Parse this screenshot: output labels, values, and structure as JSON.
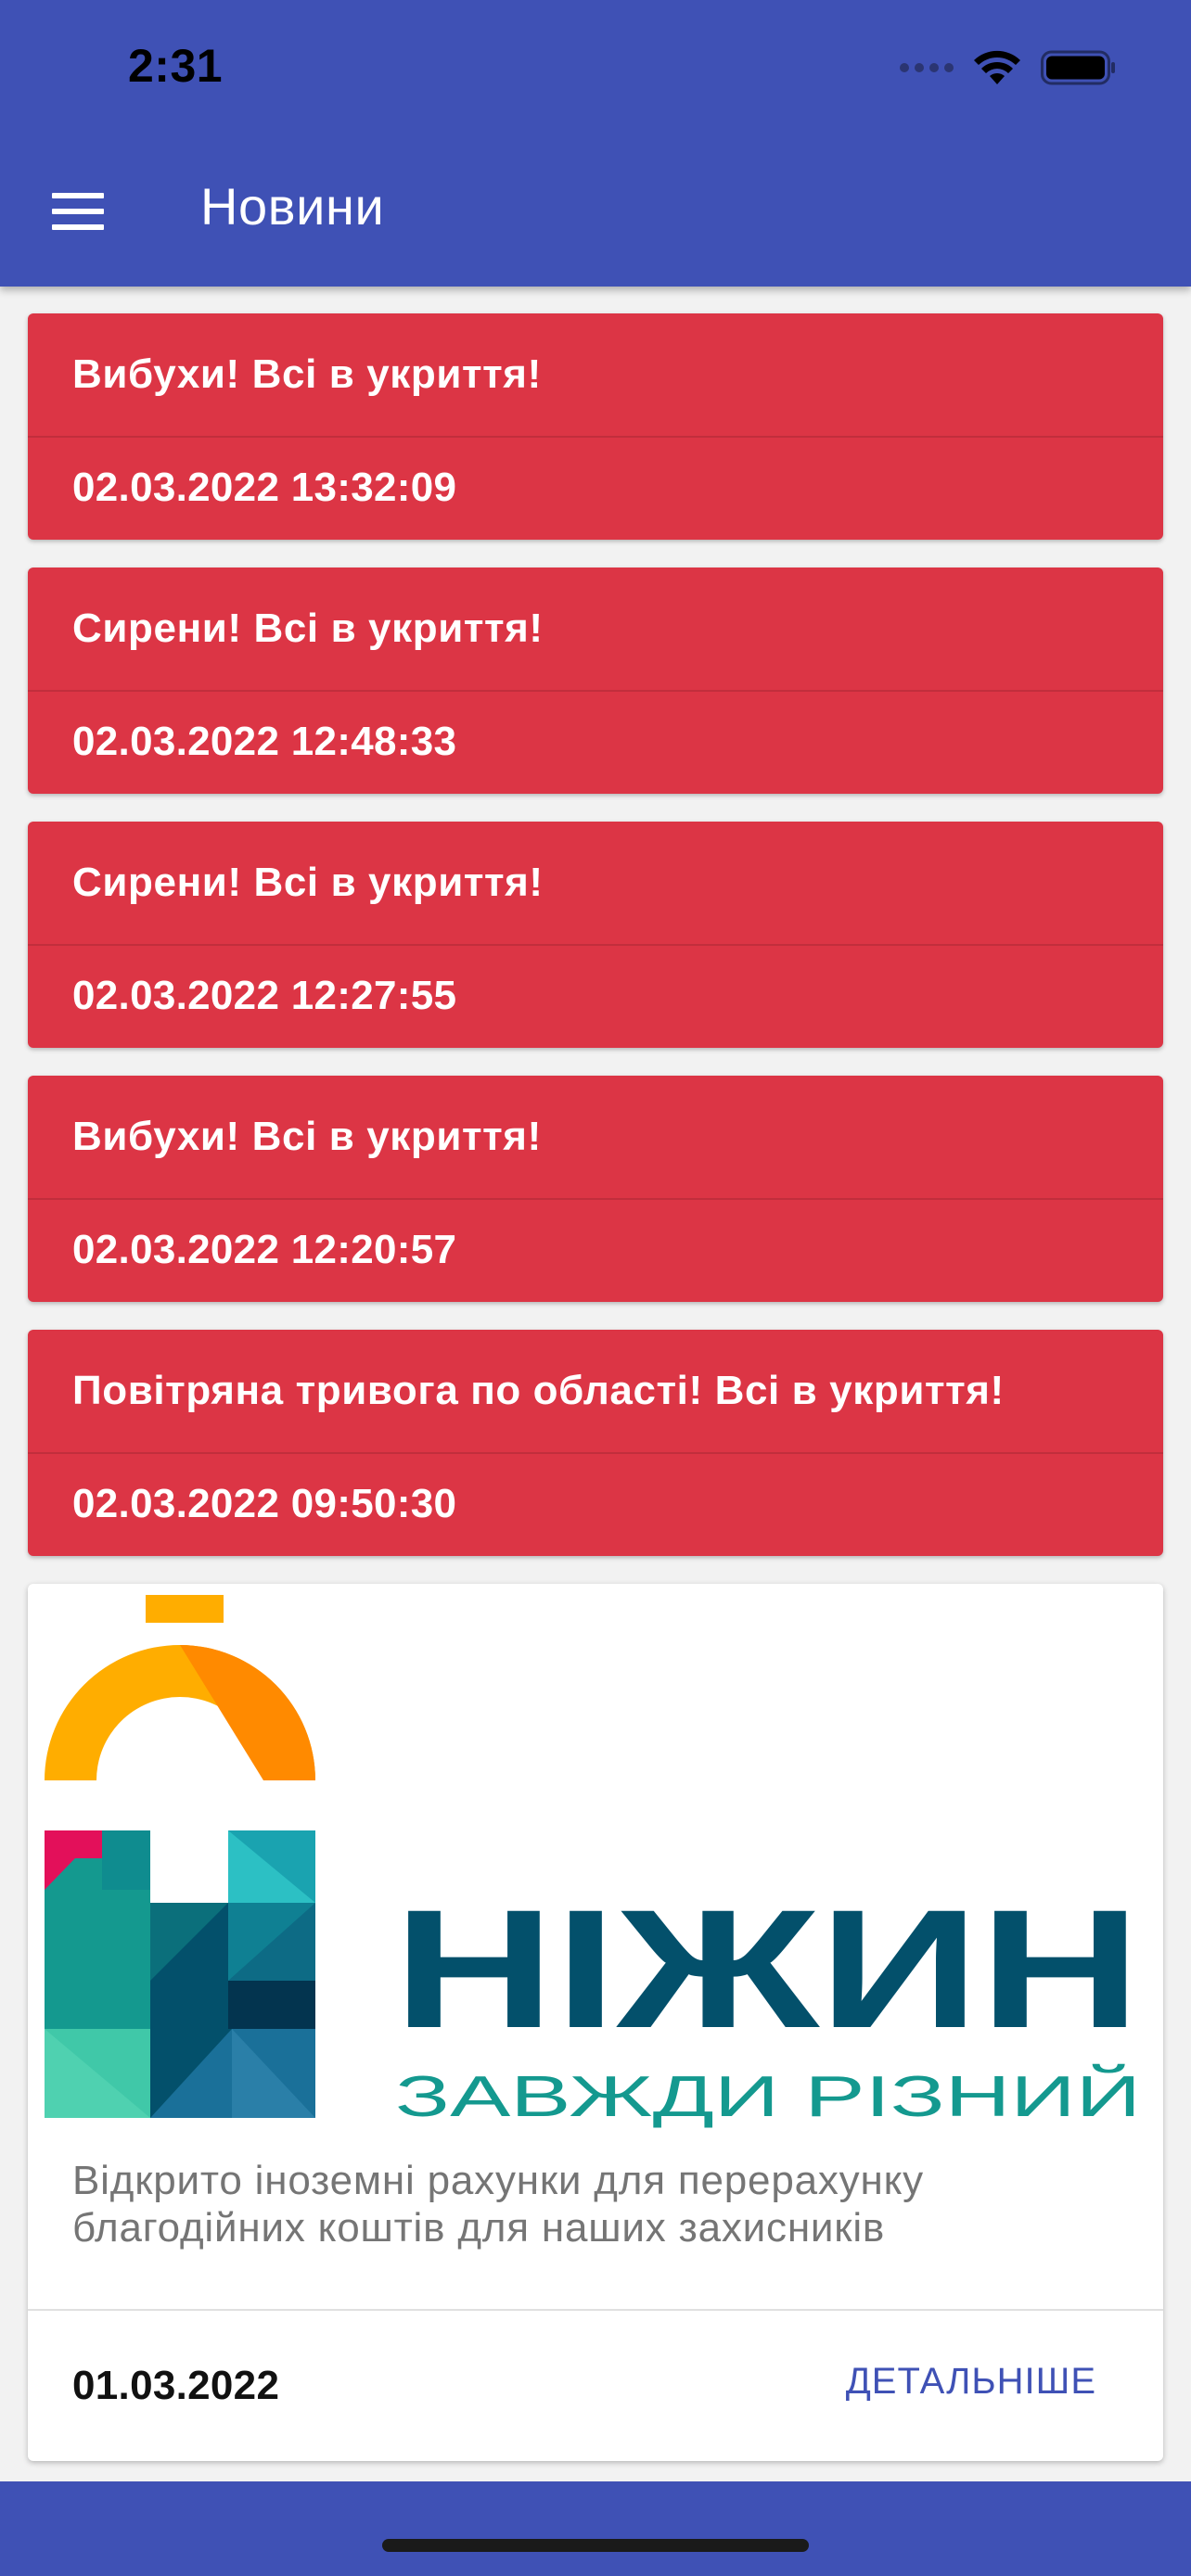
{
  "status_bar": {
    "time": "2:31"
  },
  "header": {
    "title": "Новини",
    "menu_icon": "hamburger-menu-icon"
  },
  "alerts": [
    {
      "title": "Вибухи! Всі в укриття!",
      "time": "02.03.2022 13:32:09"
    },
    {
      "title": "Сирени! Всі в укриття!",
      "time": "02.03.2022 12:48:33"
    },
    {
      "title": "Сирени! Всі в укриття!",
      "time": "02.03.2022 12:27:55"
    },
    {
      "title": "Вибухи! Всі в укриття!",
      "time": "02.03.2022 12:20:57"
    },
    {
      "title": "Повітряна тривога по області! Всі в укриття!",
      "time": "02.03.2022 09:50:30"
    }
  ],
  "news": {
    "logo_title": "НІЖИН",
    "logo_subtitle": "ЗАВЖДИ РІЗНИЙ",
    "text": "Відкрито іноземні рахунки для перерахунку благодійних коштів для наших захисників",
    "date": "01.03.2022",
    "details_label": "ДЕТАЛЬНІШЕ"
  },
  "colors": {
    "primary": "#3f51b5",
    "alert": "#dc3545",
    "logo_teal": "#03506b",
    "logo_orange": "#ffad00"
  }
}
